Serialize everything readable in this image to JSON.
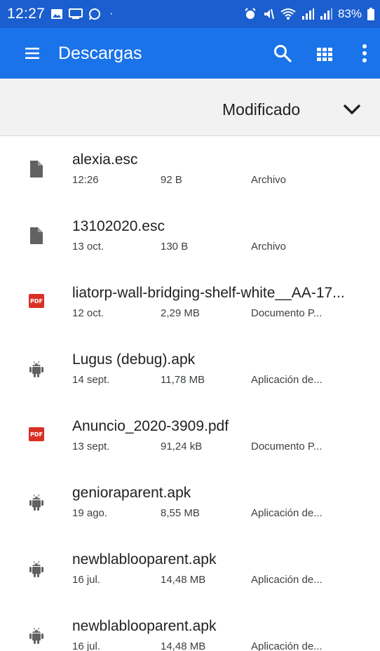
{
  "status_bar": {
    "time": "12:27",
    "dot": "·",
    "battery": "83%",
    "icons_left": [
      "image-icon",
      "cast-icon",
      "whatsapp-icon"
    ],
    "icons_right": [
      "alarm-icon",
      "mute-icon",
      "wifi-icon",
      "signal-icon",
      "signal-2-icon",
      "battery-icon"
    ]
  },
  "app_bar": {
    "title": "Descargas",
    "background": "#1a73e8",
    "status_background": "#1a5ecf",
    "icons": [
      "menu-icon",
      "search-icon",
      "grid-view-icon",
      "more-vert-icon"
    ]
  },
  "sort_bar": {
    "label": "Modificado",
    "icon": "chevron-down-icon"
  },
  "files": [
    {
      "name": "alexia.esc",
      "date": "12:26",
      "size": "92 B",
      "type": "Archivo",
      "icon": "file-icon"
    },
    {
      "name": "13102020.esc",
      "date": "13 oct.",
      "size": "130 B",
      "type": "Archivo",
      "icon": "file-icon"
    },
    {
      "name": "liatorp-wall-bridging-shelf-white__AA-17...",
      "date": "12 oct.",
      "size": "2,29 MB",
      "type": "Documento P...",
      "icon": "pdf-icon",
      "badge": "PDF"
    },
    {
      "name": "Lugus (debug).apk",
      "date": "14 sept.",
      "size": "11,78 MB",
      "type": "Aplicación de...",
      "icon": "android-icon"
    },
    {
      "name": "Anuncio_2020-3909.pdf",
      "date": "13 sept.",
      "size": "91,24 kB",
      "type": "Documento P...",
      "icon": "pdf-icon",
      "badge": "PDF"
    },
    {
      "name": "genioraparent.apk",
      "date": "19 ago.",
      "size": "8,55 MB",
      "type": "Aplicación de...",
      "icon": "android-icon"
    },
    {
      "name": "newblablooparent.apk",
      "date": "16 jul.",
      "size": "14,48 MB",
      "type": "Aplicación de...",
      "icon": "android-icon"
    },
    {
      "name": "newblablooparent.apk",
      "date": "16 jul.",
      "size": "14,48 MB",
      "type": "Aplicación de...",
      "icon": "android-icon"
    }
  ],
  "colors": {
    "pdf": "#d93025",
    "icon_gray": "#616161"
  }
}
